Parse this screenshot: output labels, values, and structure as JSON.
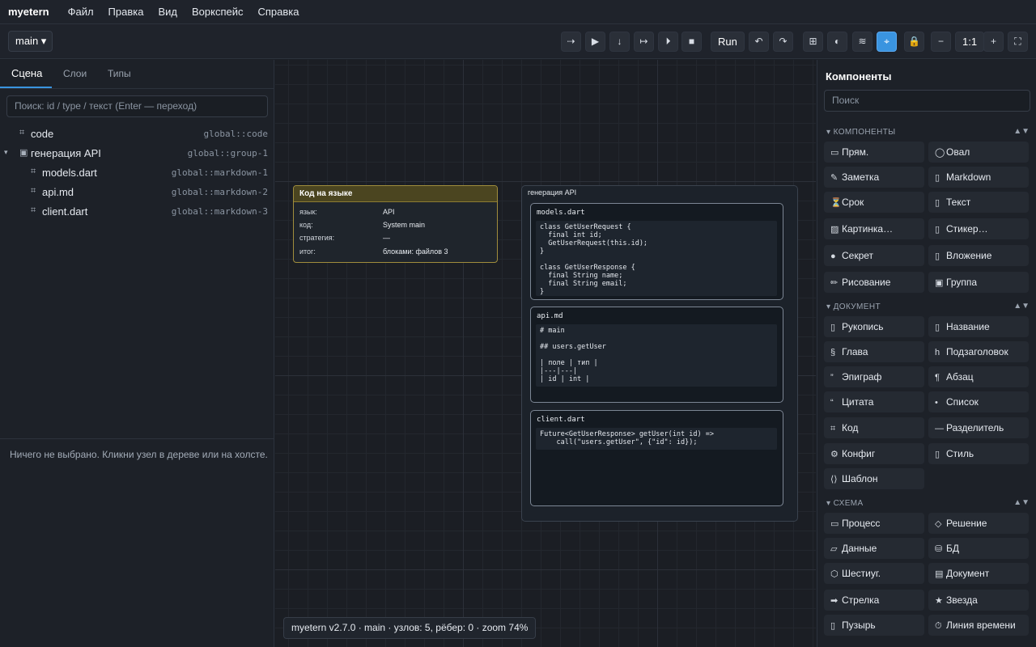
{
  "app": {
    "brand": "myetern"
  },
  "menu": [
    "Файл",
    "Правка",
    "Вид",
    "Воркспейс",
    "Справка"
  ],
  "toolbar": {
    "branch": "main ▾",
    "run_label": "Run",
    "zoom_label": "1:1",
    "icons": {
      "step": "⇢",
      "play": "▶",
      "step_in": "↓",
      "step_over": "↦",
      "next": "⏵",
      "stop": "■",
      "undo": "↶",
      "redo": "↷",
      "grid": "⊞",
      "theme": "◐",
      "wave": "≋",
      "snap": "⌖",
      "lock": "🔒",
      "zoom_out": "−",
      "zoom_in": "+",
      "fullscreen": "⛶"
    }
  },
  "left": {
    "tabs": [
      "Сцена",
      "Слои",
      "Типы"
    ],
    "search_placeholder": "Поиск: id / type / текст (Enter — переход)",
    "tree": [
      {
        "label": "code",
        "id": "global::code",
        "icon": "⌗"
      },
      {
        "label": "генерация API",
        "id": "global::group-1",
        "icon": "▣",
        "caret": "▾"
      },
      {
        "label": "models.dart",
        "id": "global::markdown-1",
        "icon": "⌗"
      },
      {
        "label": "api.md",
        "id": "global::markdown-2",
        "icon": "⌗"
      },
      {
        "label": "client.dart",
        "id": "global::markdown-3",
        "icon": "⌗"
      }
    ],
    "empty_message": "Ничего не выбрано. Кликни узел в дереве или на холсте."
  },
  "canvas": {
    "code_node": {
      "title": "Код на языке",
      "rows": [
        {
          "k": "язык:",
          "v": "API"
        },
        {
          "k": "код:",
          "v": "System main"
        },
        {
          "k": "стратегия:",
          "v": "—"
        },
        {
          "k": "итог:",
          "v": "блоками: файлов 3"
        }
      ]
    },
    "group": {
      "title": "генерация API",
      "cards": [
        {
          "name": "models.dart",
          "code": "class GetUserRequest {\n  final int id;\n  GetUserRequest(this.id);\n}\n\nclass GetUserResponse {\n  final String name;\n  final String email;\n}"
        },
        {
          "name": "api.md",
          "code": "# main\n\n## users.getUser\n\n| поле | тип |\n|---|---|\n| id | int |"
        },
        {
          "name": "client.dart",
          "code": "Future<GetUserResponse> getUser(int id) =>\n    call(\"users.getUser\", {\"id\": id});"
        }
      ]
    },
    "status": "myetern v2.7.0 · main · узлов: 5, рёбер: 0 · zoom 74%"
  },
  "right": {
    "title": "Компоненты",
    "search_placeholder": "Поиск",
    "sections": [
      {
        "title": "▾ КОМПОНЕНТЫ",
        "arrows": "▲▼",
        "items": [
          {
            "icon": "▭",
            "label": "Прям."
          },
          {
            "icon": "◯",
            "label": "Овал"
          },
          {
            "icon": "✎",
            "label": "Заметка"
          },
          {
            "icon": "▯",
            "label": "Markdown"
          },
          {
            "icon": "⏳",
            "label": "Срок"
          },
          {
            "icon": "▯",
            "label": "Текст"
          },
          {
            "icon": "▨",
            "label": "Картинка…"
          },
          {
            "icon": "▯",
            "label": "Стикер…"
          },
          {
            "icon": "●",
            "label": "Секрет"
          },
          {
            "icon": "▯",
            "label": "Вложение"
          },
          {
            "icon": "✏",
            "label": "Рисование"
          },
          {
            "icon": "▣",
            "label": "Группа"
          }
        ]
      },
      {
        "title": "▾ ДОКУМЕНТ",
        "arrows": "▲▼",
        "items": [
          {
            "icon": "▯",
            "label": "Рукопись"
          },
          {
            "icon": "▯",
            "label": "Название"
          },
          {
            "icon": "§",
            "label": "Глава"
          },
          {
            "icon": "h",
            "label": "Подзаголовок"
          },
          {
            "icon": "”",
            "label": "Эпиграф"
          },
          {
            "icon": "¶",
            "label": "Абзац"
          },
          {
            "icon": "“",
            "label": "Цитата"
          },
          {
            "icon": "•",
            "label": "Список"
          },
          {
            "icon": "⌗",
            "label": "Код"
          },
          {
            "icon": "—",
            "label": "Разделитель"
          },
          {
            "icon": "⚙",
            "label": "Конфиг"
          },
          {
            "icon": "▯",
            "label": "Стиль"
          },
          {
            "icon": "⟨⟩",
            "label": "Шаблон"
          }
        ]
      },
      {
        "title": "▾ СХЕМА",
        "arrows": "▲▼",
        "items": [
          {
            "icon": "▭",
            "label": "Процесс"
          },
          {
            "icon": "◇",
            "label": "Решение"
          },
          {
            "icon": "▱",
            "label": "Данные"
          },
          {
            "icon": "⛁",
            "label": "БД"
          },
          {
            "icon": "⬡",
            "label": "Шестиуг."
          },
          {
            "icon": "▤",
            "label": "Документ"
          },
          {
            "icon": "➡",
            "label": "Стрелка"
          },
          {
            "icon": "★",
            "label": "Звезда"
          },
          {
            "icon": "▯",
            "label": "Пузырь"
          },
          {
            "icon": "⏱",
            "label": "Линия времени"
          }
        ]
      }
    ]
  },
  "colors": {
    "accent": "#3a94e0",
    "code_node_border": "#a08d3c",
    "canvas_bg": "#1b1e24"
  }
}
